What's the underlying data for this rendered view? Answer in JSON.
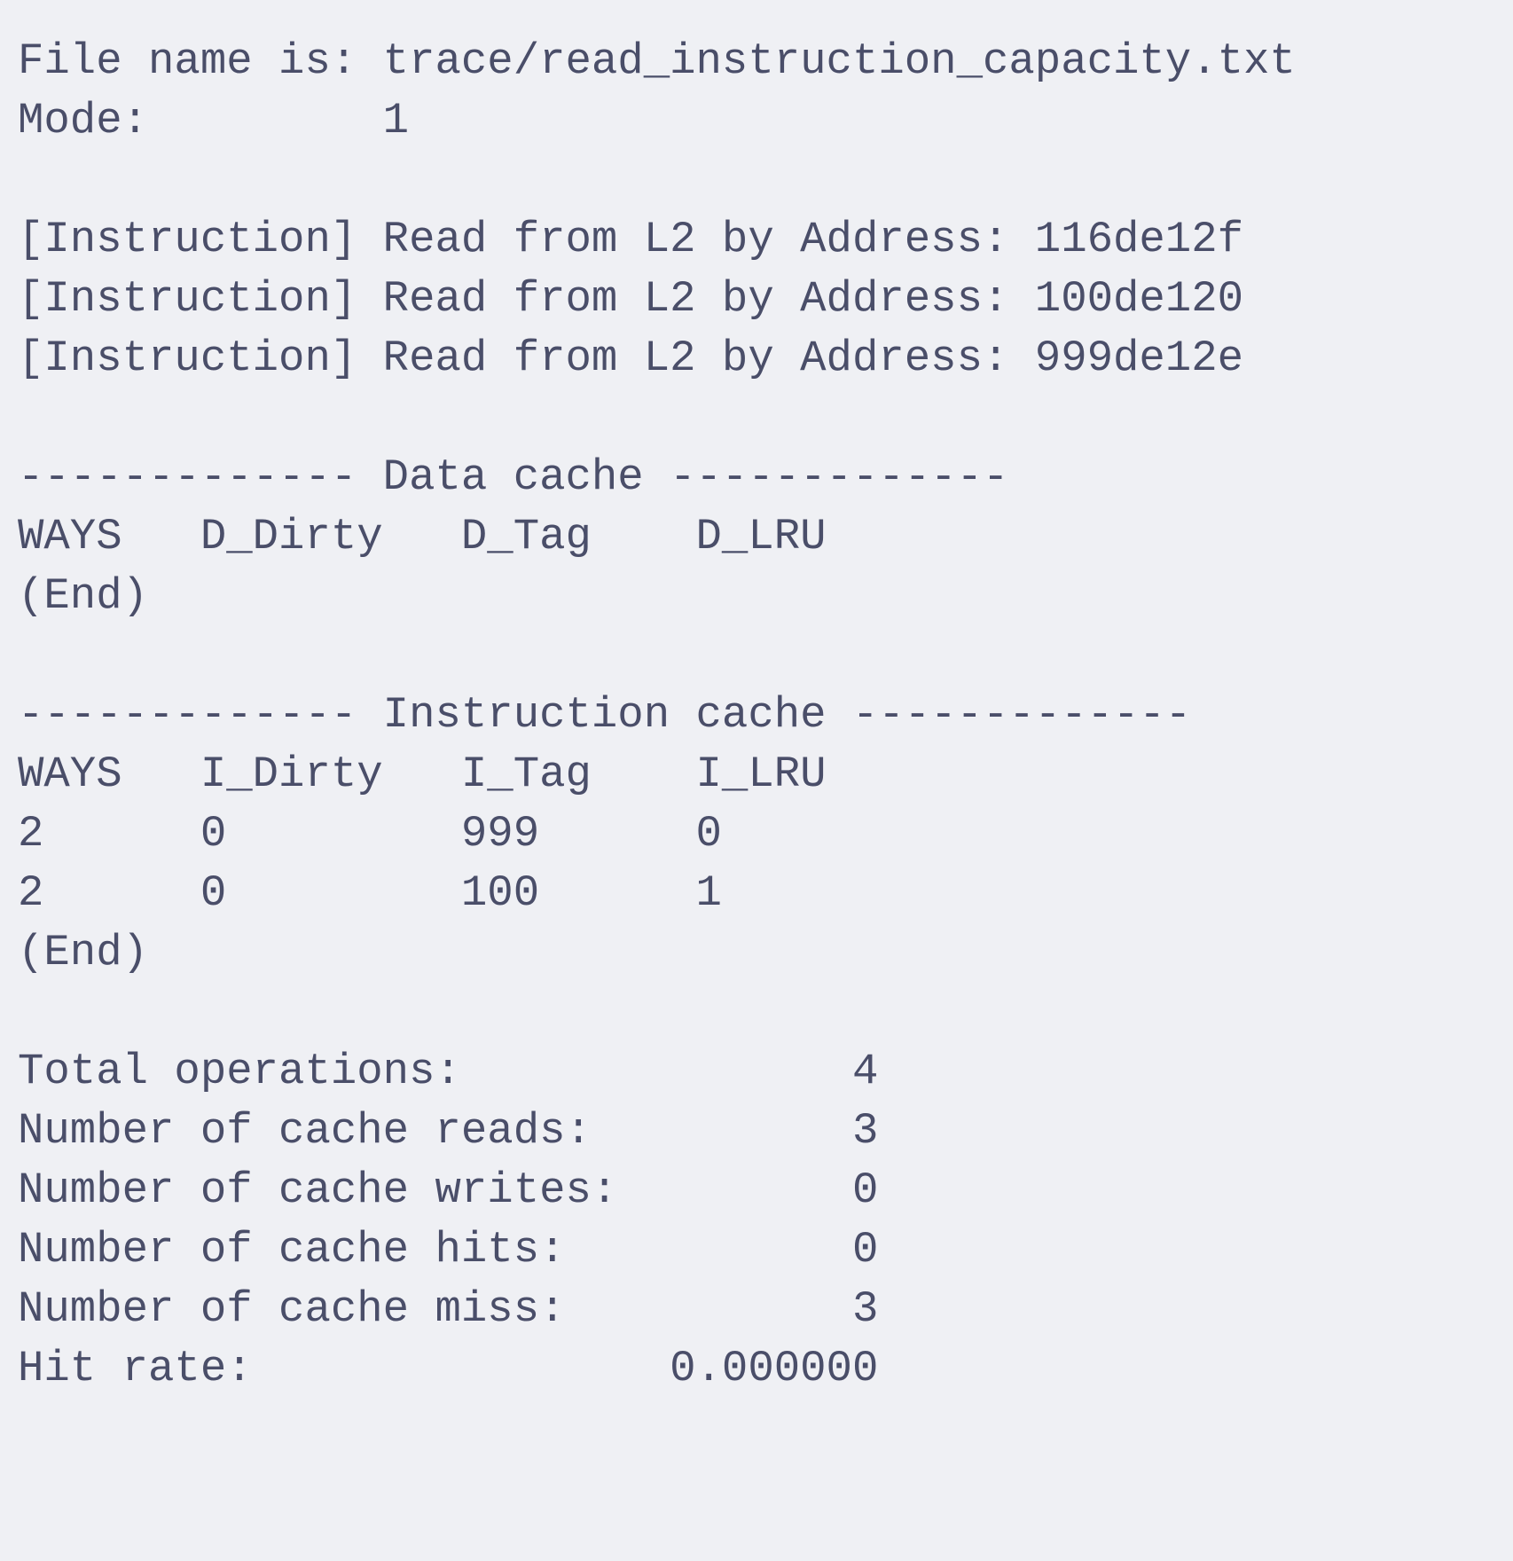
{
  "lines": [
    "File name is: trace/read_instruction_capacity.txt",
    "Mode:         1",
    "",
    "[Instruction] Read from L2 by Address: 116de12f",
    "[Instruction] Read from L2 by Address: 100de120",
    "[Instruction] Read from L2 by Address: 999de12e",
    "",
    "------------- Data cache -------------",
    "WAYS   D_Dirty   D_Tag    D_LRU",
    "(End)",
    "",
    "------------- Instruction cache -------------",
    "WAYS   I_Dirty   I_Tag    I_LRU",
    "2      0         999      0",
    "2      0         100      1",
    "(End)",
    "",
    "Total operations:               4",
    "Number of cache reads:          3",
    "Number of cache writes:         0",
    "Number of cache hits:           0",
    "Number of cache miss:           3",
    "Hit rate:                0.000000"
  ]
}
